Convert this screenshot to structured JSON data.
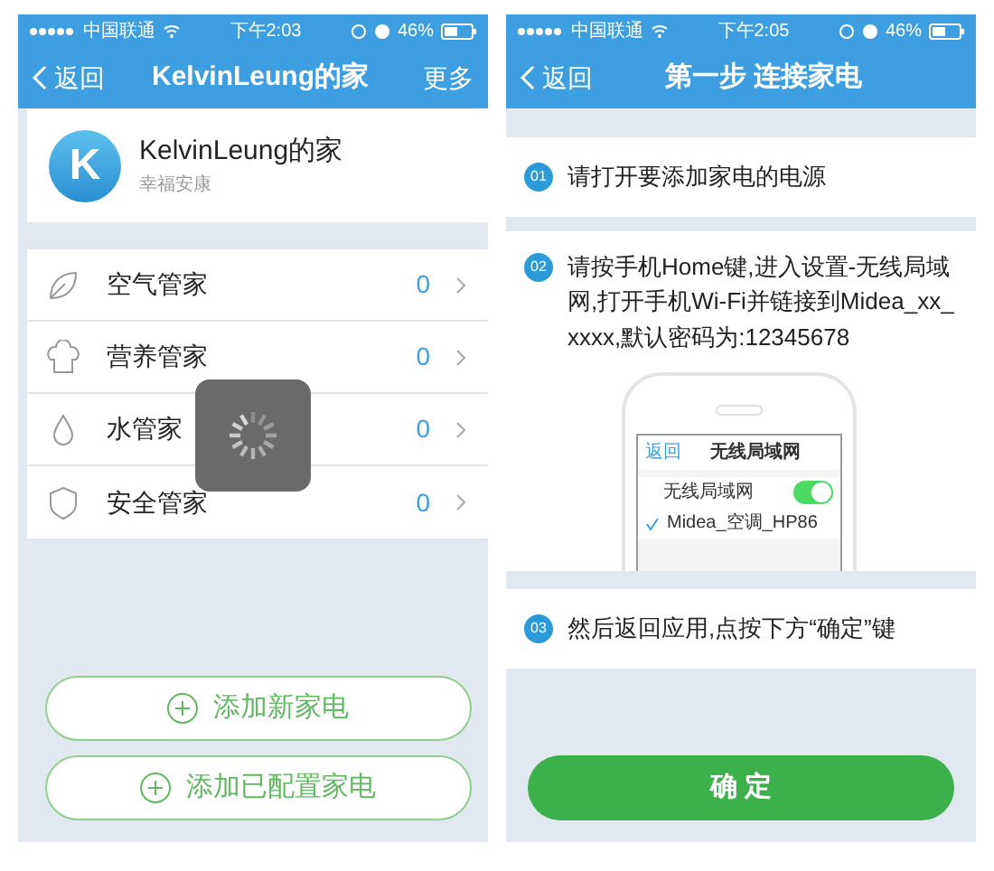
{
  "home_screen": {
    "status_bar": {
      "carrier": "中国联通",
      "time": "下午2:03",
      "battery": "46%"
    },
    "nav": {
      "back": "返回",
      "title": "KelvinLeung的家",
      "action": "更多"
    },
    "profile": {
      "avatar_letter": "K",
      "name": "KelvinLeung的家",
      "subtitle": "幸福安康"
    },
    "categories": [
      {
        "label": "空气管家",
        "count": "0"
      },
      {
        "label": "营养管家",
        "count": "0"
      },
      {
        "label": "水管家",
        "count": "0"
      },
      {
        "label": "安全管家",
        "count": "0"
      }
    ],
    "buttons": [
      "添加新家电",
      "添加已配置家电"
    ]
  },
  "setup_screen": {
    "status_bar": {
      "carrier": "中国联通",
      "time": "下午2:05",
      "battery": "46%"
    },
    "nav": {
      "back": "返回",
      "title": "第一步 连接家电"
    },
    "steps": [
      {
        "number": "01",
        "text": "请打开要添加家电的电源"
      },
      {
        "number": "02",
        "text": "请按手机Home键,进入设置-无线局域网,打开手机Wi-Fi并链接到Midea_xx_xxxx,默认密码为:12345678",
        "illustration": {
          "back": "返回",
          "title": "无线局域网",
          "wifi_label": "无线局域网",
          "wifi_on": true,
          "network": "Midea_空调_HP86",
          "network_checked": true
        }
      },
      {
        "number": "03",
        "text": "然后返回应用,点按下方“确定”键"
      }
    ],
    "confirm_button": "确 定"
  }
}
